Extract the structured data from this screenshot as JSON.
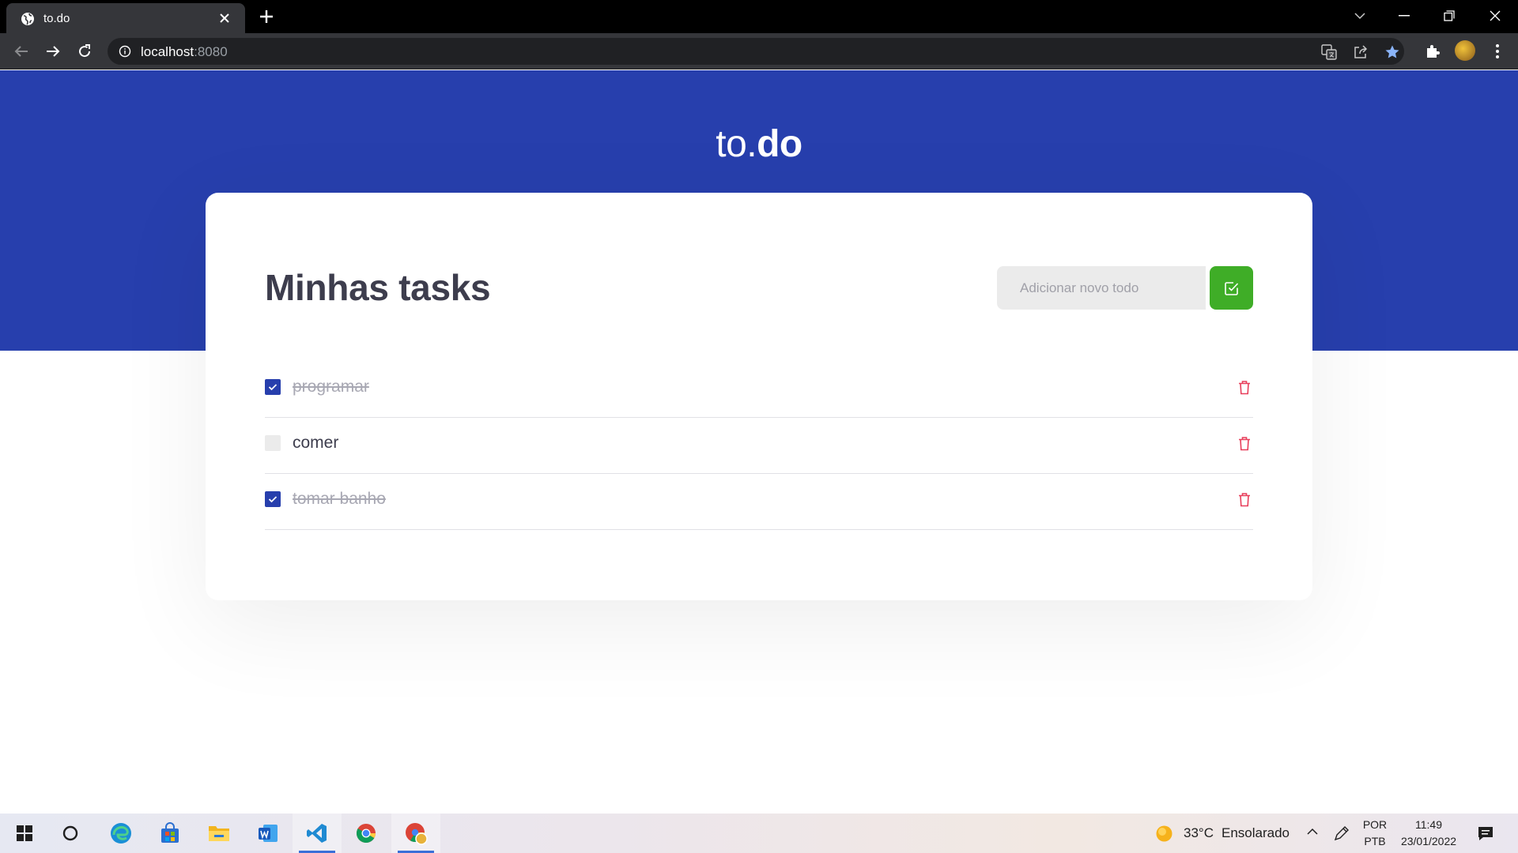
{
  "browser": {
    "tab_title": "to.do",
    "url_host": "localhost",
    "url_port": ":8080"
  },
  "app": {
    "brand_light": "to.",
    "brand_bold": "do",
    "heading": "Minhas tasks",
    "add_placeholder": "Adicionar novo todo",
    "tasks": [
      {
        "label": "programar",
        "done": true
      },
      {
        "label": "comer",
        "done": false
      },
      {
        "label": "tomar banho",
        "done": true
      }
    ]
  },
  "taskbar": {
    "weather_temp": "33°C",
    "weather_desc": "Ensolarado",
    "lang_line1": "POR",
    "lang_line2": "PTB",
    "time": "11:49",
    "date": "23/01/2022"
  },
  "colors": {
    "brand_blue": "#273fad",
    "add_green": "#3fad27",
    "delete_red": "#e83f5b"
  }
}
